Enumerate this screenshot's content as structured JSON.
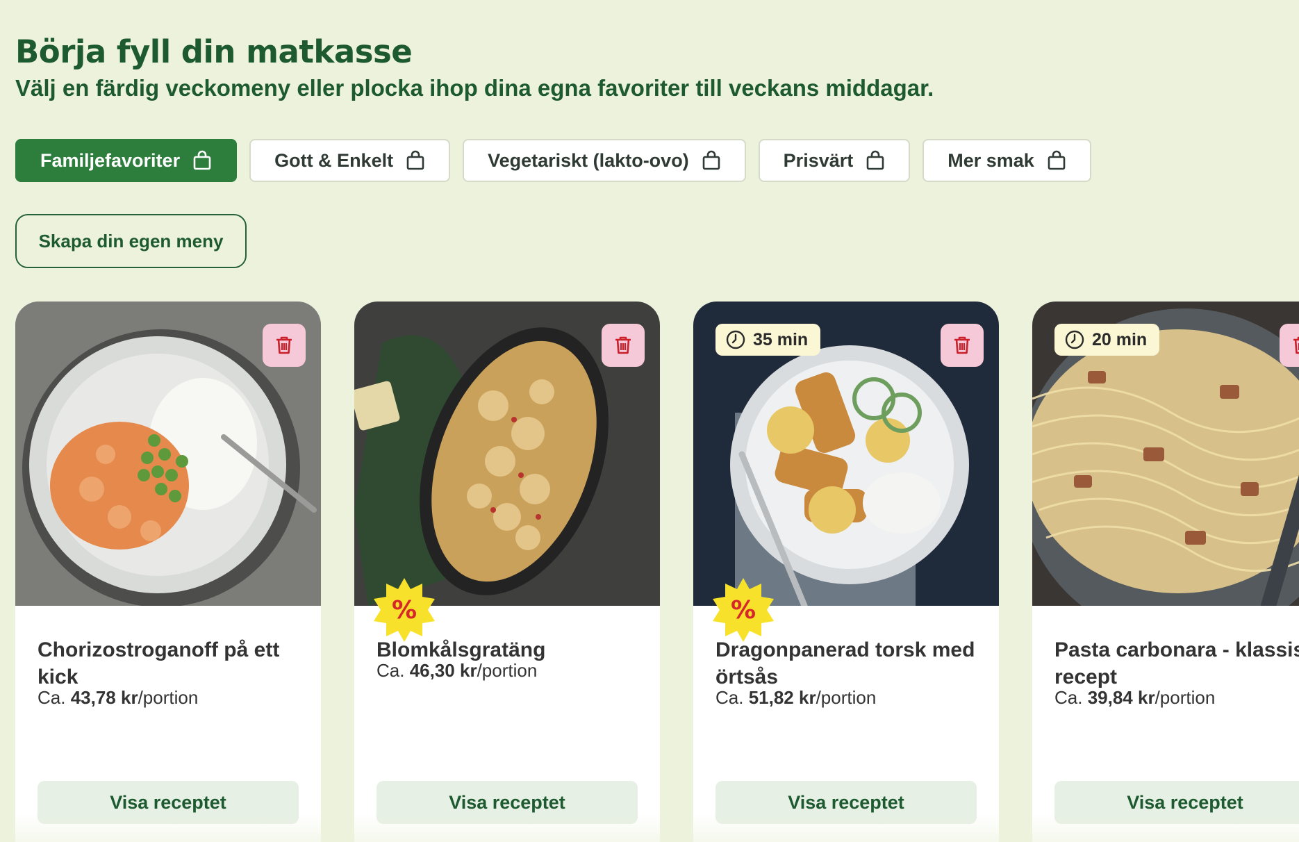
{
  "header": {
    "title": "Börja fyll din matkasse",
    "subtitle": "Välj en färdig veckomeny eller plocka ihop dina egna favoriter till veckans middagar."
  },
  "tabs": [
    {
      "label": "Familjefavoriter",
      "active": true,
      "icon": "shopping-bag-icon"
    },
    {
      "label": "Gott & Enkelt",
      "active": false,
      "icon": "shopping-bag-icon"
    },
    {
      "label": "Vegetariskt (lakto-ovo)",
      "active": false,
      "icon": "shopping-bag-icon"
    },
    {
      "label": "Prisvärt",
      "active": false,
      "icon": "shopping-bag-icon"
    },
    {
      "label": "Mer smak",
      "active": false,
      "icon": "shopping-bag-icon"
    }
  ],
  "create_menu_label": "Skapa din egen meny",
  "recipes": [
    {
      "title": "Chorizostroganoff på ett kick",
      "price_prefix": "Ca.",
      "price": "43,78 kr",
      "price_unit": "/portion",
      "time": "",
      "on_sale": false,
      "cta": "Visa receptet",
      "icon": "trash-icon"
    },
    {
      "title": "Blomkålsgratäng",
      "price_prefix": "Ca.",
      "price": "46,30 kr",
      "price_unit": "/portion",
      "time": "",
      "on_sale": true,
      "sale_symbol": "%",
      "cta": "Visa receptet",
      "icon": "trash-icon"
    },
    {
      "title": "Dragonpanerad torsk med örtsås",
      "price_prefix": "Ca.",
      "price": "51,82 kr",
      "price_unit": "/portion",
      "time": "35 min",
      "on_sale": true,
      "sale_symbol": "%",
      "cta": "Visa receptet",
      "icon": "trash-icon"
    },
    {
      "title": "Pasta carbonara - klassiskt recept",
      "price_prefix": "Ca.",
      "price": "39,84 kr",
      "price_unit": "/portion",
      "time": "20 min",
      "on_sale": false,
      "cta": "Visa receptet",
      "icon": "trash-icon"
    }
  ],
  "colors": {
    "background": "#edf2dd",
    "brand_green": "#2d7d3c",
    "heading_green": "#1d5a30",
    "trash_pink": "#f6c9d9",
    "sale_yellow": "#f7e12a",
    "sale_red": "#d6262a",
    "time_badge": "#fbf6d4"
  }
}
